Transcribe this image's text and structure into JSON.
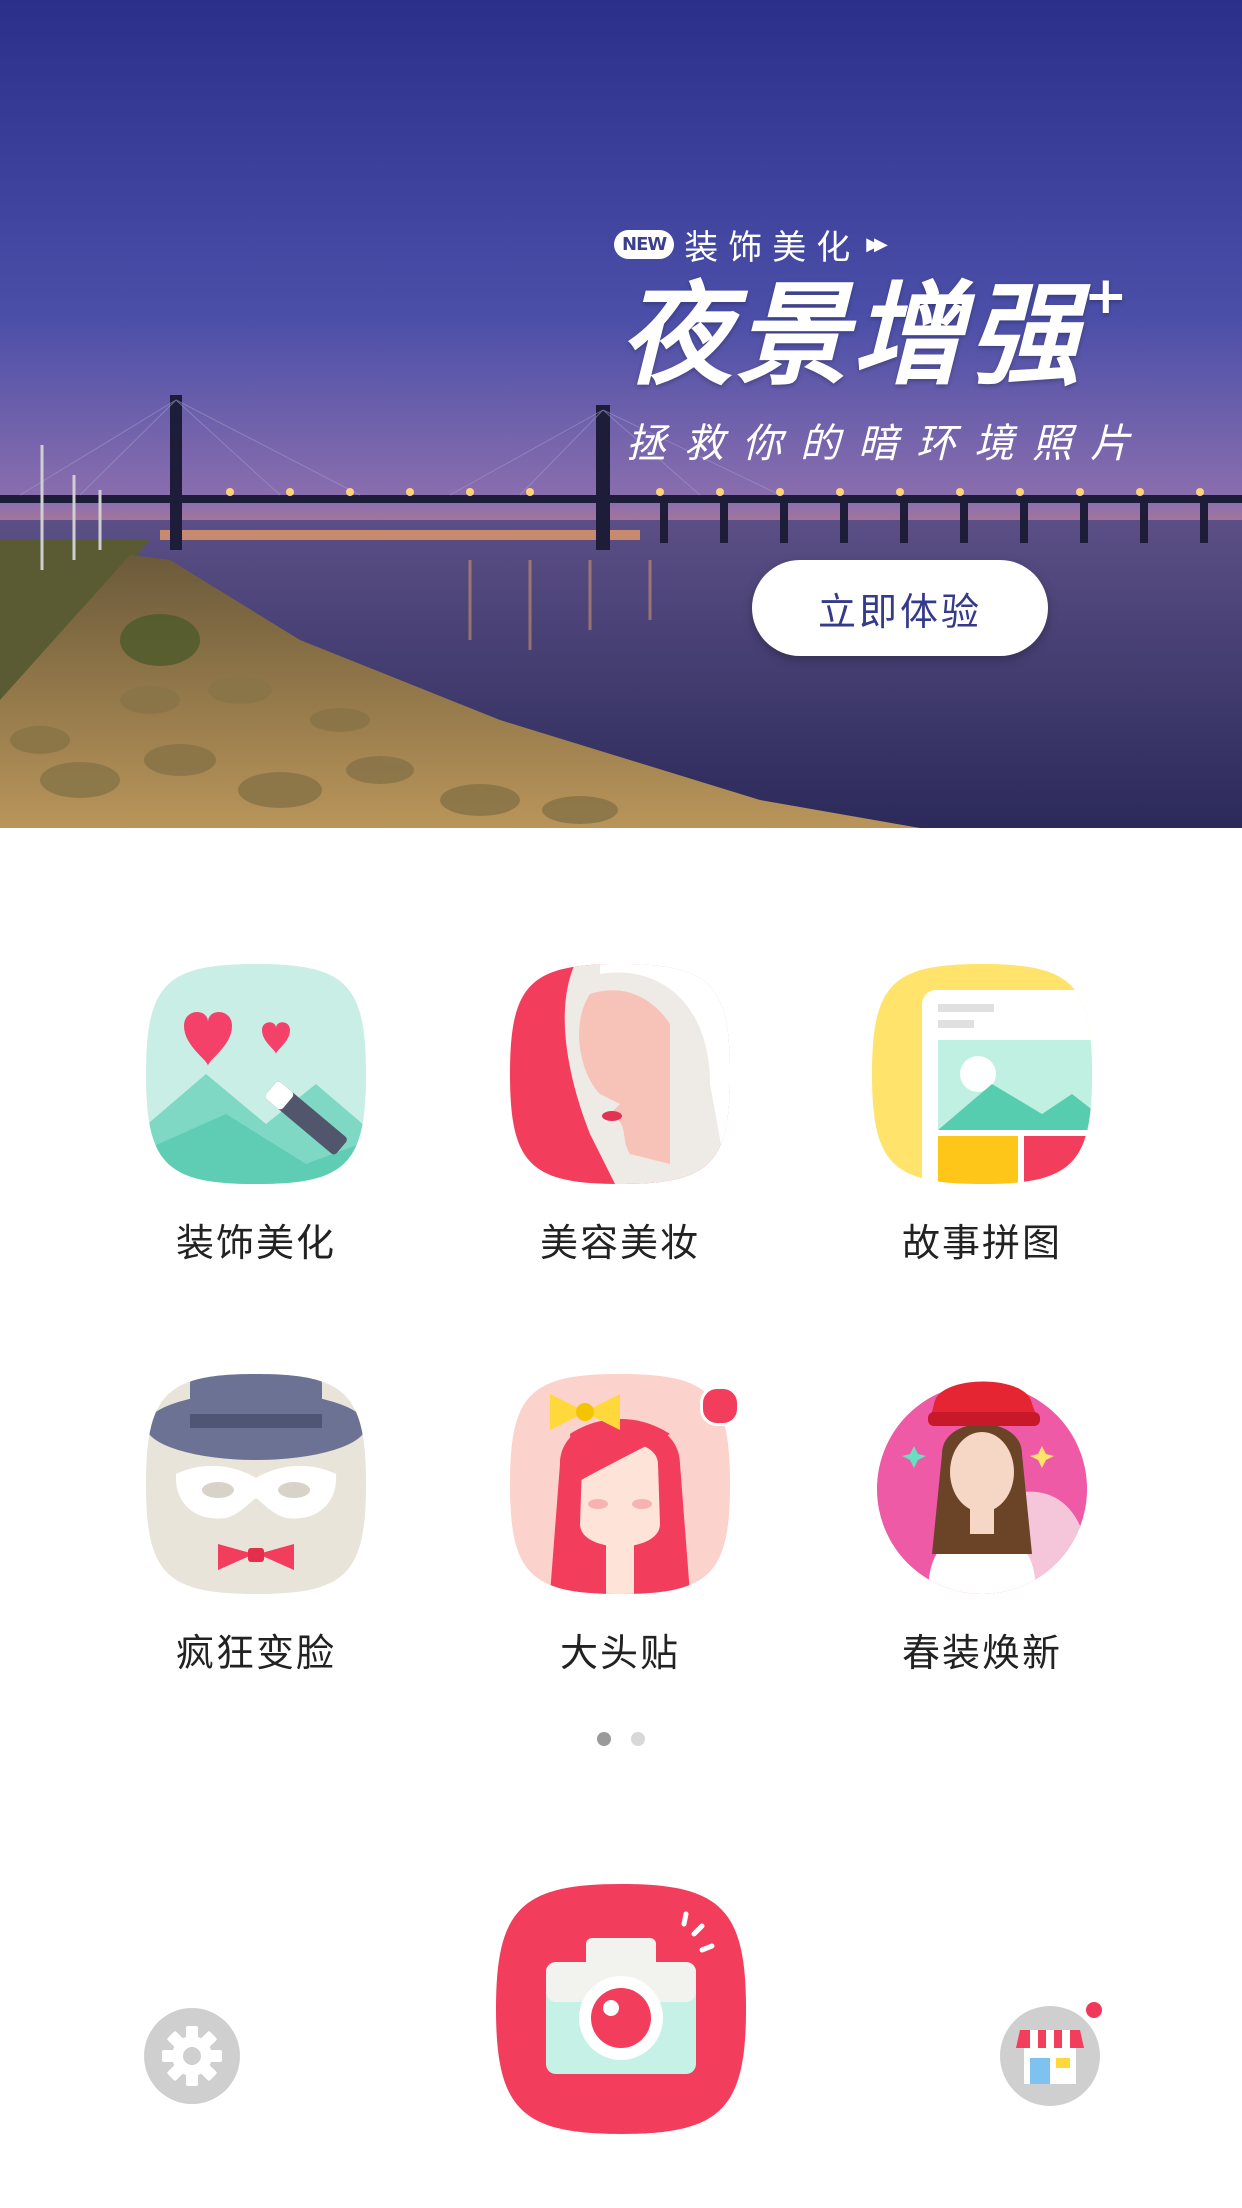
{
  "banner": {
    "badge": "NEW",
    "tag": "装饰美化",
    "title": "夜景增强",
    "title_sup": "+",
    "subtitle": "拯救你的暗环境照片",
    "button_label": "立即体验"
  },
  "features": [
    {
      "label": "装饰美化",
      "icon": "decorate-icon"
    },
    {
      "label": "美容美妆",
      "icon": "makeup-icon"
    },
    {
      "label": "故事拼图",
      "icon": "collage-icon"
    },
    {
      "label": "疯狂变脸",
      "icon": "mask-icon"
    },
    {
      "label": "大头贴",
      "icon": "sticker-girl-icon",
      "badge": true
    },
    {
      "label": "春装焕新",
      "icon": "spring-outfit-photo"
    }
  ],
  "pager": {
    "page_count": 2,
    "current_page": 1
  },
  "bottom_bar": {
    "settings_icon": "gear-icon",
    "camera_icon": "camera-icon",
    "store_icon": "store-icon",
    "store_badge": true
  },
  "colors": {
    "accent": "#f2385a",
    "banner_button_text": "#353b8a",
    "icon_gray": "#cccccc"
  }
}
